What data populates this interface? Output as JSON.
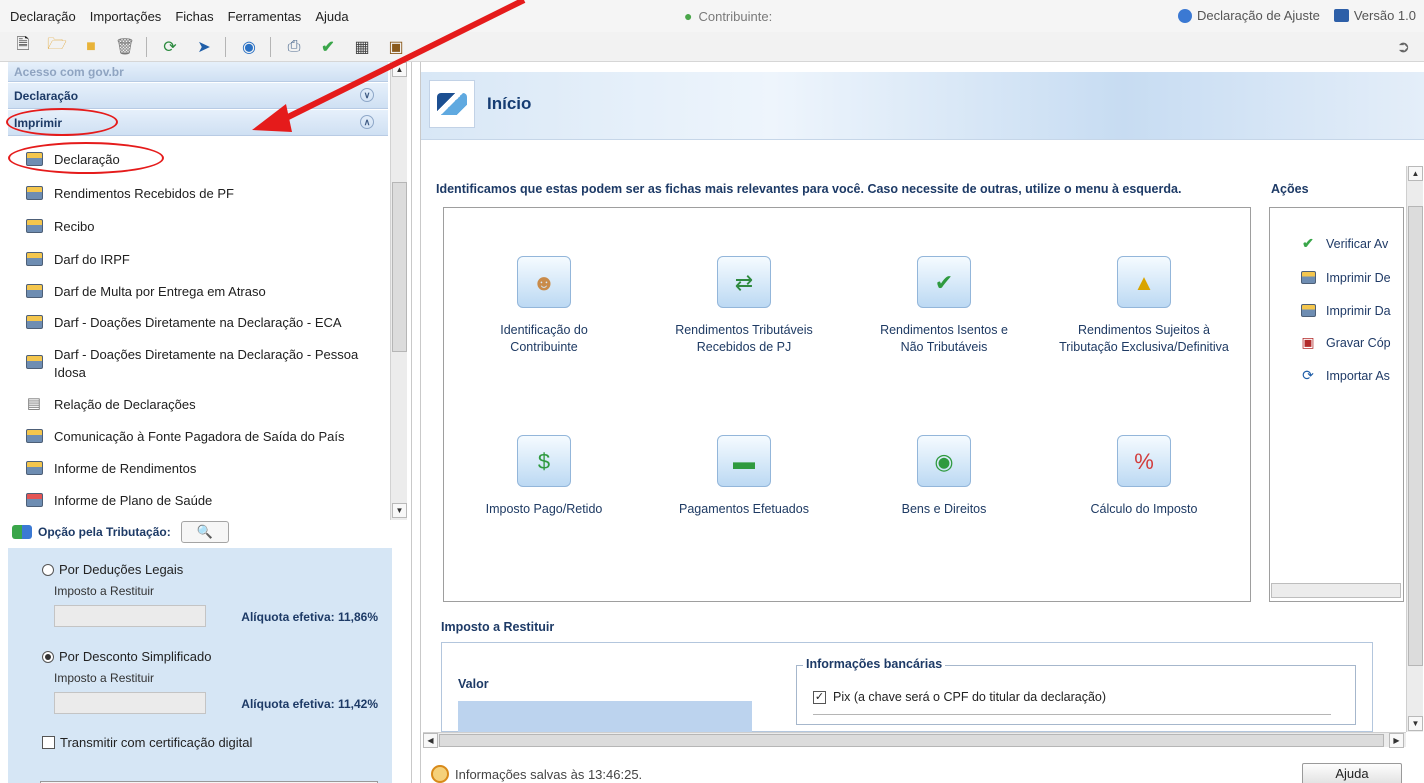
{
  "menubar": {
    "items": [
      "Declaração",
      "Importações",
      "Fichas",
      "Ferramentas",
      "Ajuda"
    ],
    "contribuinte_label": "Contribuinte:",
    "declaracao_tipo": "Declaração de Ajuste",
    "versao": "Versão 1.0"
  },
  "toolbar": {
    "icons": [
      "new-file-icon",
      "open-file-icon",
      "folder-icon",
      "trash-icon",
      "sync-icon",
      "transmit-icon",
      "receita-icon",
      "print-icon",
      "verify-check-icon",
      "calculator-icon",
      "help-book-icon",
      "exit-icon"
    ]
  },
  "sidebar": {
    "faded_header": "Acesso com gov.br",
    "declaracao_header": "Declaração",
    "imprimir_header": "Imprimir",
    "imprimir_items": [
      "Declaração",
      "Rendimentos Recebidos de PF",
      "Recibo",
      "Darf do IRPF",
      "Darf de Multa por Entrega em Atraso",
      "Darf - Doações Diretamente na Declaração - ECA",
      "Darf - Doações Diretamente na Declaração - Pessoa Idosa",
      "Relação de Declarações",
      "Comunicação à Fonte Pagadora de Saída do País",
      "Informe de Rendimentos",
      "Informe de Plano de Saúde"
    ]
  },
  "tributacao": {
    "title": "Opção pela Tributação:",
    "opcao1_label": "Por Deduções Legais",
    "opcao1_sub": "Imposto a Restituir",
    "opcao1_aliquota": "Alíquota efetiva: 11,86%",
    "opcao1_selected": false,
    "opcao2_label": "Por Desconto Simplificado",
    "opcao2_sub": "Imposto a Restituir",
    "opcao2_aliquota": "Alíquota efetiva: 11,42%",
    "opcao2_selected": true,
    "certificacao_label": "Transmitir com certificação digital",
    "certificacao_checked": false
  },
  "main": {
    "page_title": "Início",
    "relevant_text": "Identificamos que estas podem ser as fichas mais relevantes para você. Caso necessite de outras, utilize o menu à esquerda.",
    "cards": [
      {
        "label": "Identificação do Contribuinte",
        "icon": "person-icon"
      },
      {
        "label": "Rendimentos Tributáveis Recebidos de PJ",
        "icon": "income-pj-icon"
      },
      {
        "label": "Rendimentos Isentos e Não Tributáveis",
        "icon": "exempt-income-icon"
      },
      {
        "label": "Rendimentos Sujeitos à Tributação Exclusiva/Definitiva",
        "icon": "exclusive-tax-icon"
      },
      {
        "label": "Imposto Pago/Retido",
        "icon": "tax-paid-icon"
      },
      {
        "label": "Pagamentos Efetuados",
        "icon": "card-payment-icon"
      },
      {
        "label": "Bens e Direitos",
        "icon": "assets-icon"
      },
      {
        "label": "Cálculo do Imposto",
        "icon": "percent-icon"
      }
    ],
    "acoes_title": "Ações",
    "acoes": [
      "Verificar Av",
      "Imprimir De",
      "Imprimir Da",
      "Gravar Cóp",
      "Importar As"
    ],
    "imposto_title": "Imposto a Restituir",
    "valor_label": "Valor",
    "informacoes_bancarias": "Informações bancárias",
    "pix_label": "Pix (a chave será o CPF do titular da declaração)",
    "pix_checked": true
  },
  "status": {
    "message": "Informações salvas às 13:46:25.",
    "ajuda_label": "Ajuda"
  },
  "colors": {
    "annotation_red": "#e51b1b",
    "header_blue": "#1d3a66",
    "panel_blue": "#d6e6f5"
  }
}
